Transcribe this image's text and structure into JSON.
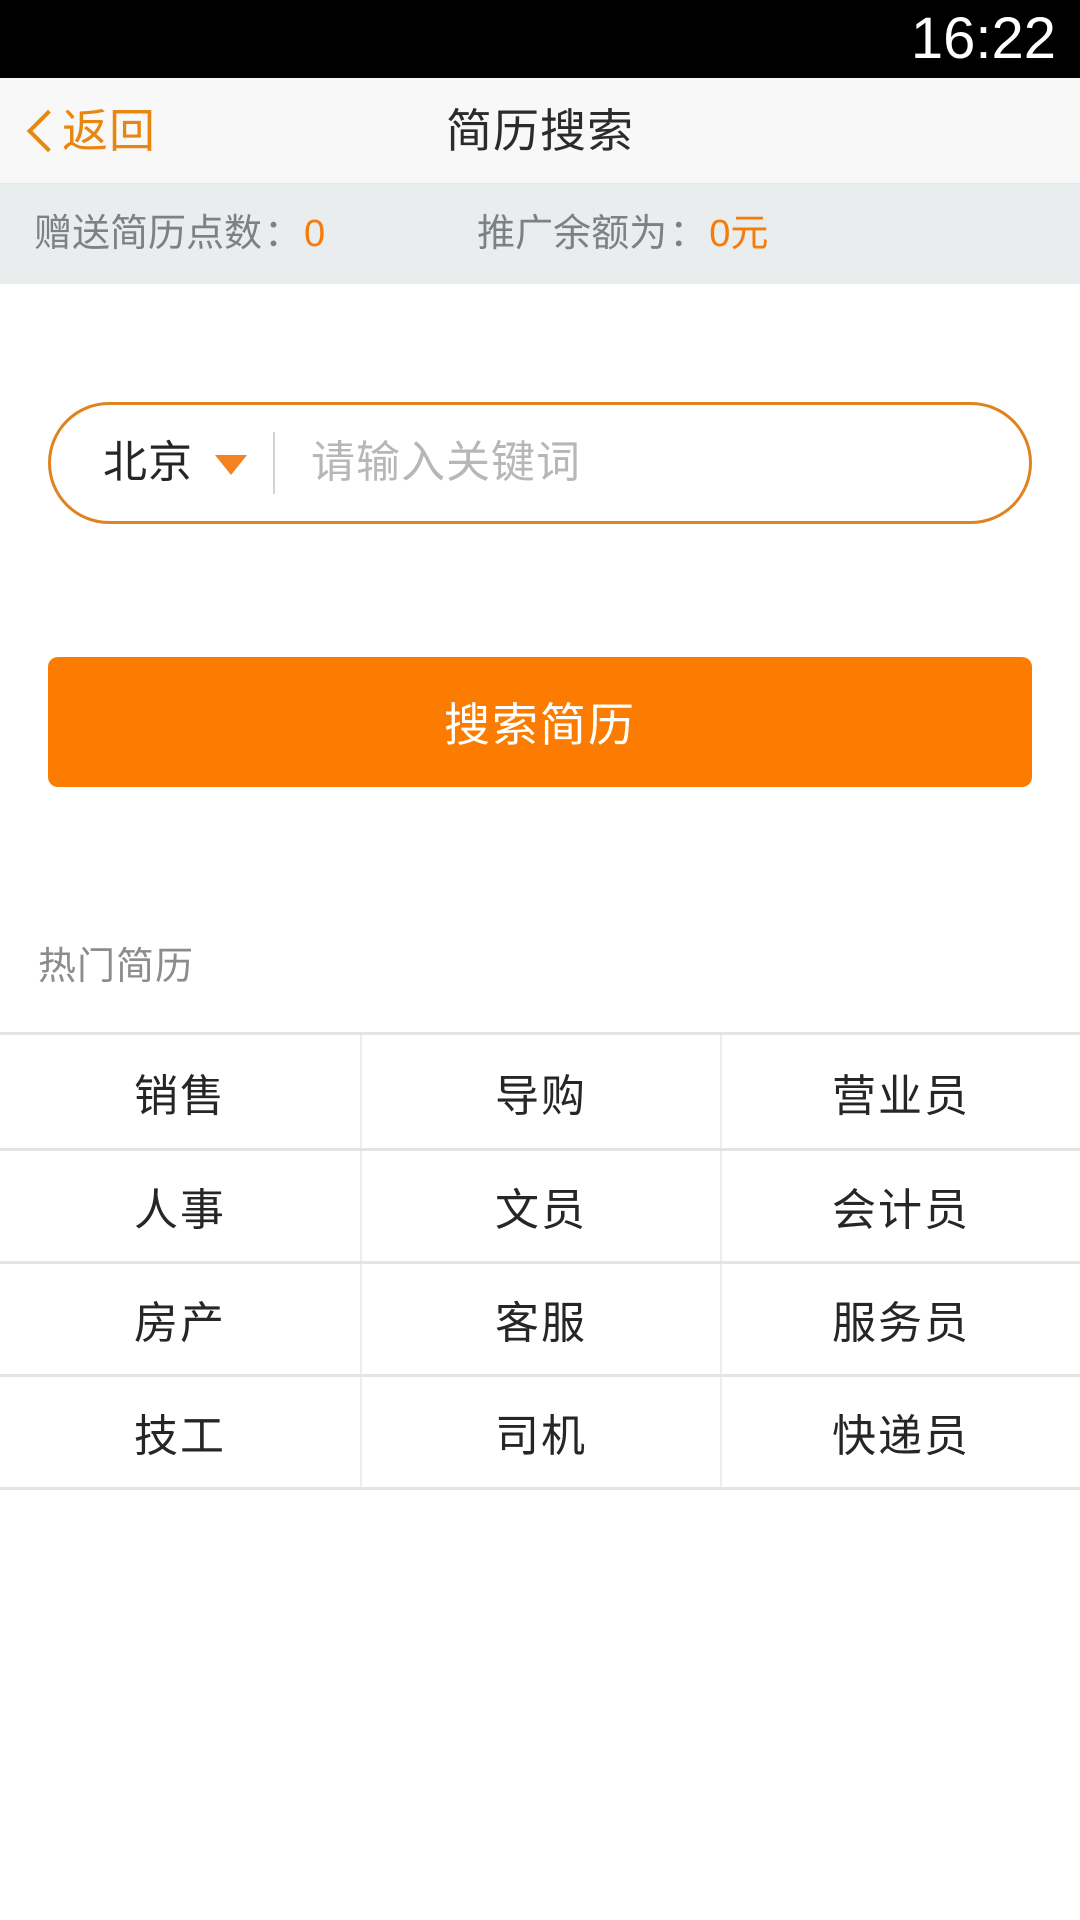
{
  "status_bar": {
    "time": "16:22"
  },
  "nav": {
    "back_label": "返回",
    "back_icon": "chevron-left-icon",
    "title": "简历搜索"
  },
  "info_bar": {
    "points": {
      "label": "赠送简历点数",
      "colon": "：",
      "value": "0"
    },
    "balance": {
      "label": "推广余额为",
      "colon": "：",
      "value": "0",
      "unit": "元"
    }
  },
  "search": {
    "city": "北京",
    "caret_icon": "caret-down-icon",
    "placeholder": "请输入关键词",
    "value": "",
    "button_label": "搜索简历"
  },
  "hot_section": {
    "title": "热门简历",
    "rows": [
      [
        "销售",
        "导购",
        "营业员"
      ],
      [
        "人事",
        "文员",
        "会计员"
      ],
      [
        "房产",
        "客服",
        "服务员"
      ],
      [
        "技工",
        "司机",
        "快递员"
      ]
    ]
  },
  "colors": {
    "accent_orange": "#fb7c00",
    "border_orange": "#e0831f",
    "nav_orange": "#e8870f",
    "info_bg": "#e9edee",
    "nav_bg": "#f8f8f8",
    "grid_border": "#e4e4e4"
  }
}
